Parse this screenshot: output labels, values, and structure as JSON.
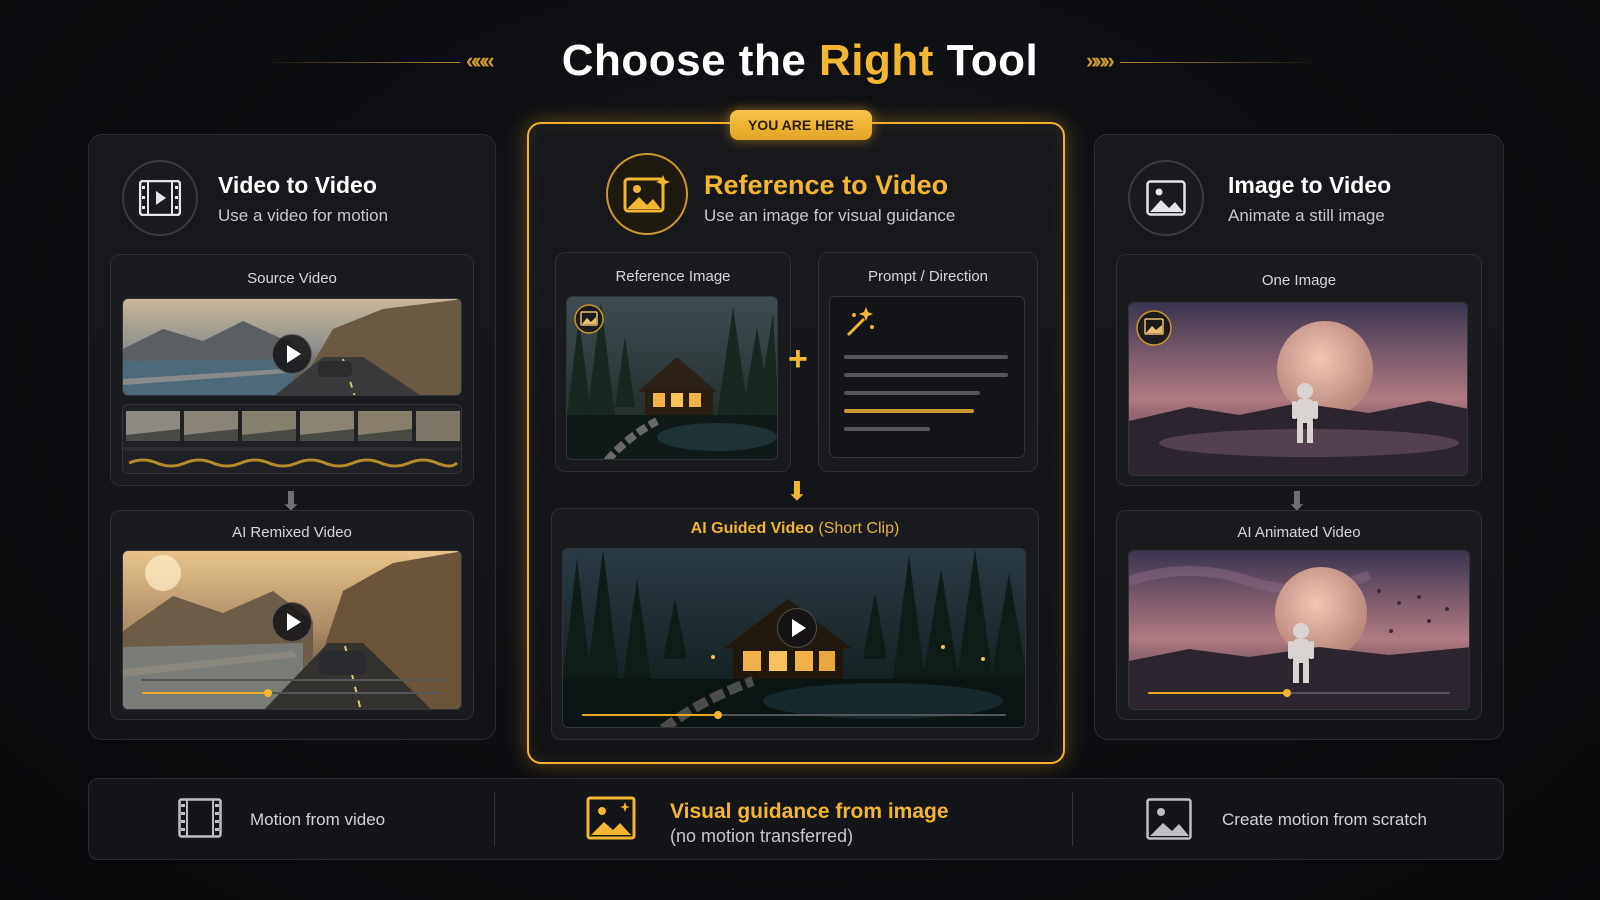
{
  "header": {
    "title_part1": "Choose the ",
    "title_accent": "Right",
    "title_part2": " Tool",
    "deco_left": "«««",
    "deco_right": "»»»"
  },
  "colors": {
    "accent": "#f2b632",
    "panel_bg": "#17181c",
    "border": "#2c2d33"
  },
  "panels": [
    {
      "icon": "film-play-icon",
      "title": "Video to Video",
      "subtitle": "Use a video for motion",
      "input_label": "Source Video",
      "output_label": "AI Remixed Video",
      "output_progress": 0.42
    },
    {
      "badge": "YOU ARE HERE",
      "icon": "image-sparkle-icon",
      "title": "Reference to Video",
      "subtitle": "Use an image for visual guidance",
      "input_label": "Reference Image",
      "prompt_label": "Prompt / Direction",
      "plus": "+",
      "output_label": "AI Guided Video",
      "output_label_suffix": "(Short Clip)",
      "output_progress": 0.32
    },
    {
      "icon": "image-icon",
      "title": "Image to Video",
      "subtitle": "Animate a still image",
      "input_label": "One Image",
      "output_label": "AI Animated Video",
      "output_progress": 0.46
    }
  ],
  "bottom": [
    {
      "icon": "film-icon",
      "label": "Motion from video"
    },
    {
      "icon": "image-icon",
      "label": "Visual guidance from image",
      "sublabel": "(no motion transferred)"
    },
    {
      "icon": "image-icon",
      "label": "Create motion from scratch"
    }
  ]
}
